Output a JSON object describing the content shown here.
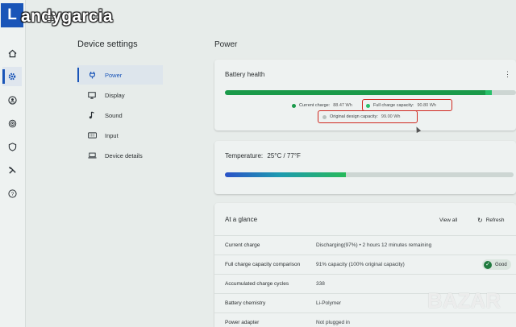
{
  "watermark_user": "andygarcia",
  "logo_letter": "L",
  "device_settings_title": "Device settings",
  "nav": [
    {
      "label": "Power",
      "icon": "power-plug-icon",
      "active": true
    },
    {
      "label": "Display",
      "icon": "monitor-icon",
      "active": false
    },
    {
      "label": "Sound",
      "icon": "music-note-icon",
      "active": false
    },
    {
      "label": "Input",
      "icon": "keyboard-icon",
      "active": false
    },
    {
      "label": "Device details",
      "icon": "laptop-icon",
      "active": false
    }
  ],
  "rail_icons": [
    "home-icon",
    "gear-icon",
    "account-icon",
    "radar-icon",
    "shield-icon",
    "tools-icon",
    "help-icon"
  ],
  "power_title": "Power",
  "battery_health": {
    "title": "Battery health",
    "current_charge_label": "Current charge:",
    "current_charge_value": "88.47 Wh",
    "full_charge_label": "Full charge capacity:",
    "full_charge_value": "90.80 Wh",
    "original_label": "Original design capacity:",
    "original_value": "99.00 Wh",
    "current_charge_fraction": 0.8936,
    "full_charge_fraction": 0.9172
  },
  "temperature": {
    "label": "Temperature:",
    "value": "25°C / 77°F",
    "fill_fraction": 0.42
  },
  "glance": {
    "title": "At a glance",
    "view_all": "View all",
    "refresh": "Refresh",
    "rows": [
      {
        "key": "Current charge",
        "value": "Discharging(97%)  •  2 hours 12 minutes remaining"
      },
      {
        "key": "Full charge capacity comparison",
        "value": "91% capacity (100% original capacity)",
        "badge": "Good"
      },
      {
        "key": "Accumulated charge cycles",
        "value": "338"
      },
      {
        "key": "Battery chemistry",
        "value": "Li-Polymer"
      },
      {
        "key": "Power adapter",
        "value": "Not plugged in"
      }
    ]
  },
  "colors": {
    "accent": "#1a55b8",
    "green": "#1a9a4a",
    "annotation_red": "#d0281f"
  },
  "watermark_brand": "BAZAR"
}
